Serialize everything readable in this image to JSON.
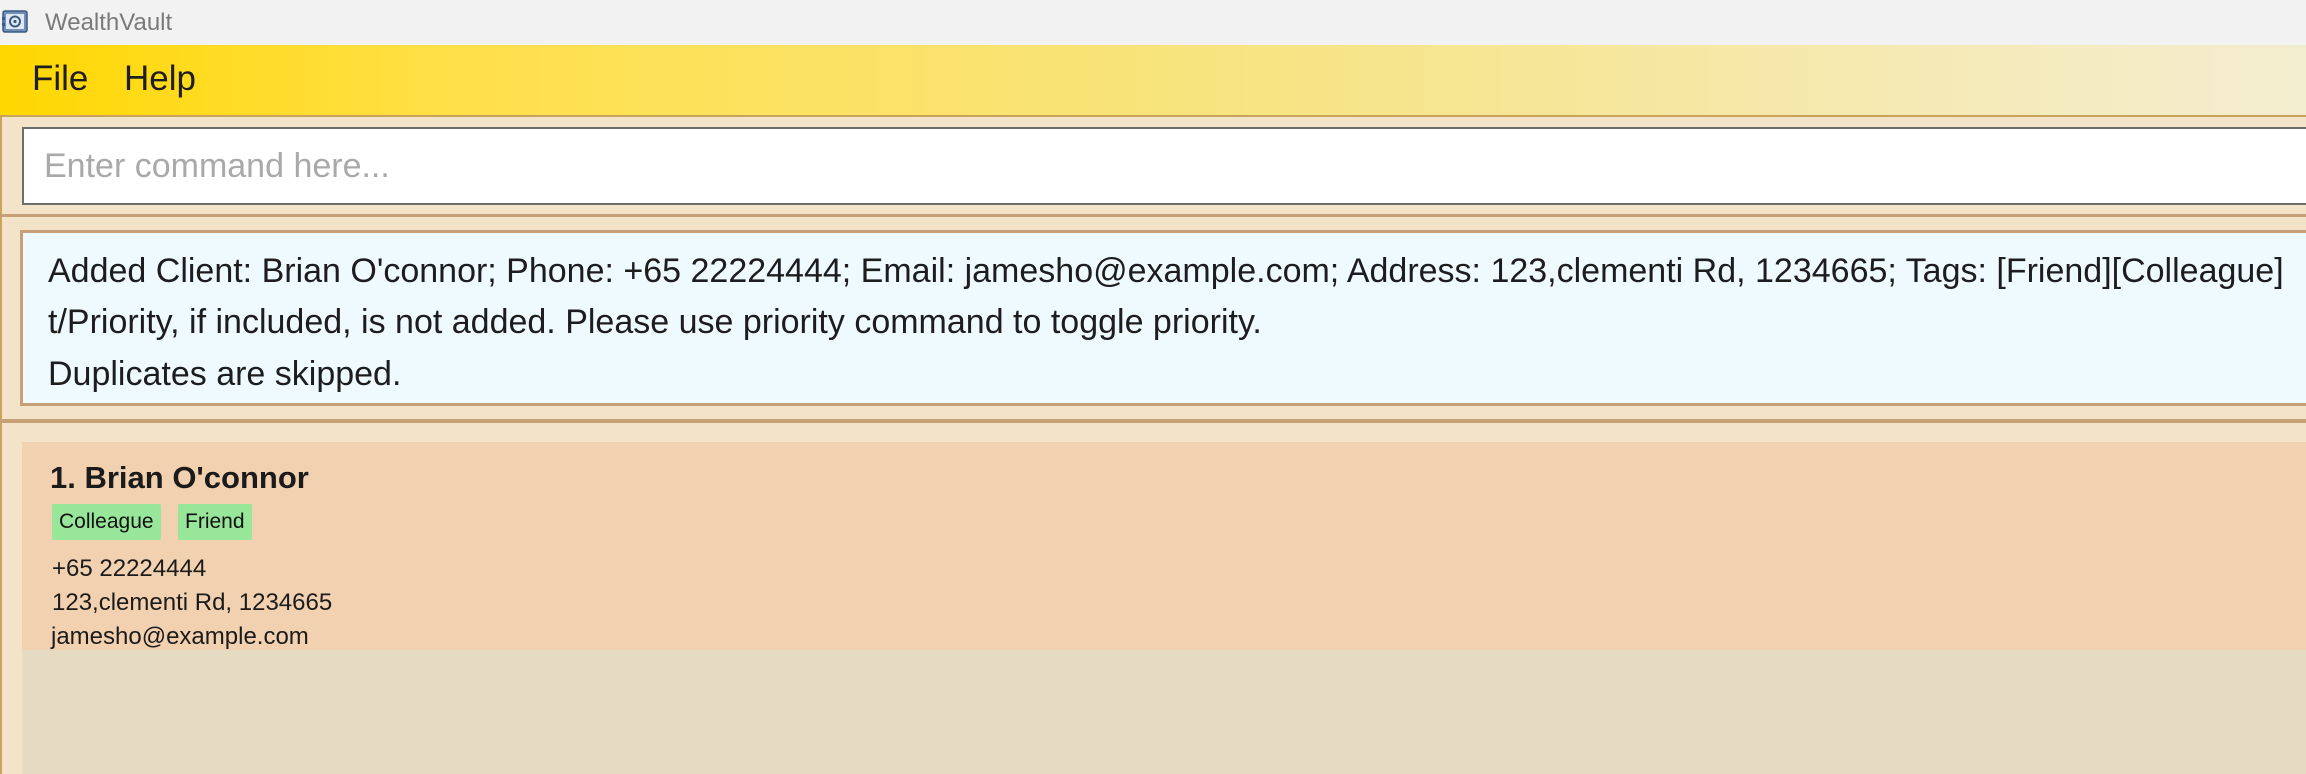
{
  "window": {
    "title": "WealthVault"
  },
  "menu": {
    "file": "File",
    "help": "Help"
  },
  "command": {
    "placeholder": "Enter command here...",
    "value": ""
  },
  "result": {
    "lines": [
      "Added Client: Brian O'connor; Phone: +65 22224444; Email: jamesho@example.com; Address: 123,clementi Rd, 1234665; Tags: [Friend][Colleague]",
      "t/Priority, if included, is not added. Please use priority command to toggle priority.",
      "Duplicates are skipped."
    ]
  },
  "clients": [
    {
      "index_name": "1. Brian O'connor",
      "tags": [
        "Colleague",
        "Friend"
      ],
      "phone": "+65 22224444",
      "address": "123,clementi Rd, 1234665",
      "email": "jamesho@example.com"
    }
  ],
  "colors": {
    "menubar_start": "#ffd700",
    "result_bg": "#eefaff",
    "card_bg": "#f2d1b0",
    "tag_bg": "#98e69a",
    "list_bg": "#e6dac2"
  },
  "icons": {
    "app": "app-icon"
  }
}
